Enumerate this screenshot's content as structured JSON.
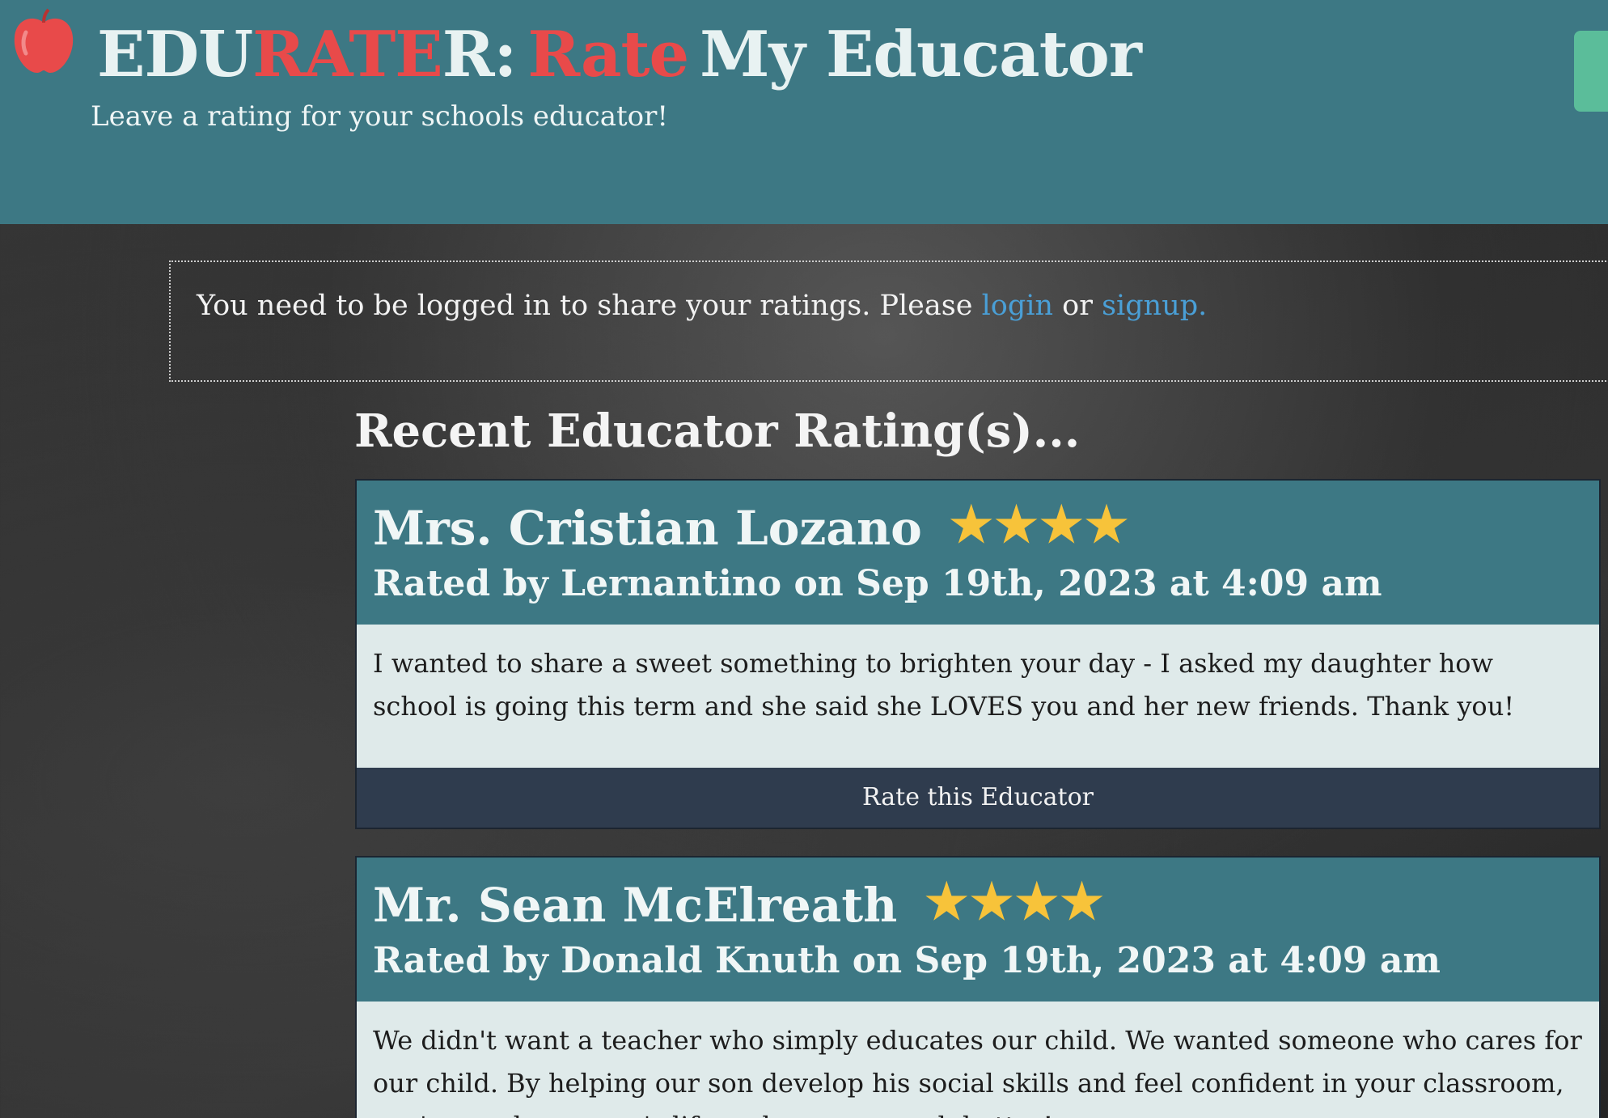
{
  "header": {
    "brand_edu": "EDU",
    "brand_rater": "RATE",
    "brand_r": "R:",
    "brand_rate": "Rate",
    "brand_rest": "My Educator",
    "tagline": "Leave a rating for your schools educator!"
  },
  "notice": {
    "text_before": "You need to be logged in to share your ratings. Please",
    "login": "login",
    "or": "or",
    "signup": "signup."
  },
  "section_title": "Recent Educator Rating(s)...",
  "ratings": [
    {
      "name": "Mrs. Cristian Lozano",
      "stars": 4,
      "stars_text": "★★★★",
      "meta": "Rated by Lernantino on Sep 19th, 2023 at 4:09 am",
      "body": "I wanted to share a sweet something to brighten your day - I asked my daughter how school is going this term and she said she LOVES you and her new friends. Thank you!",
      "button": "Rate this Educator"
    },
    {
      "name": "Mr. Sean McElreath",
      "stars": 4,
      "stars_text": "★★★★",
      "meta": "Rated by Donald Knuth on Sep 19th, 2023 at 4:09 am",
      "body": "We didn't want a teacher who simply educates our child. We wanted someone who cares for our child. By helping our son develop his social skills and feel confident in your classroom, you've made our son's life and ours so much better!"
    }
  ],
  "colors": {
    "header_bg": "#3d7884",
    "accent_red": "#e84a4a",
    "star": "#f7c33a",
    "link": "#4a9fd6",
    "button_bg": "#2f3c4e"
  }
}
